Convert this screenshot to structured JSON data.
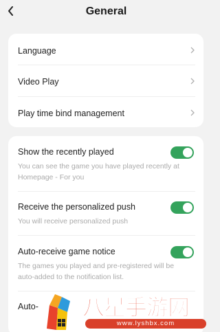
{
  "header": {
    "title": "General"
  },
  "colors": {
    "toggle_on": "#34a35c",
    "background": "#f2f2f2",
    "watermark": "#e8432c"
  },
  "card1": {
    "items": [
      {
        "label": "Language"
      },
      {
        "label": "Video Play"
      },
      {
        "label": "Play time bind management"
      }
    ]
  },
  "card2": {
    "items": [
      {
        "label": "Show the recently played",
        "desc": "You can see the game you have played recently at Homepage - For you",
        "enabled": true
      },
      {
        "label": "Receive the personalized push",
        "desc": "You will receive personalized push",
        "enabled": true
      },
      {
        "label": "Auto-receive game notice",
        "desc": "The games you played and pre-registered will be auto-added to the notification list.",
        "enabled": true
      },
      {
        "label": "Auto-"
      }
    ]
  },
  "watermark": {
    "text": "八星手游网",
    "url": "www.lyshbx.com"
  }
}
